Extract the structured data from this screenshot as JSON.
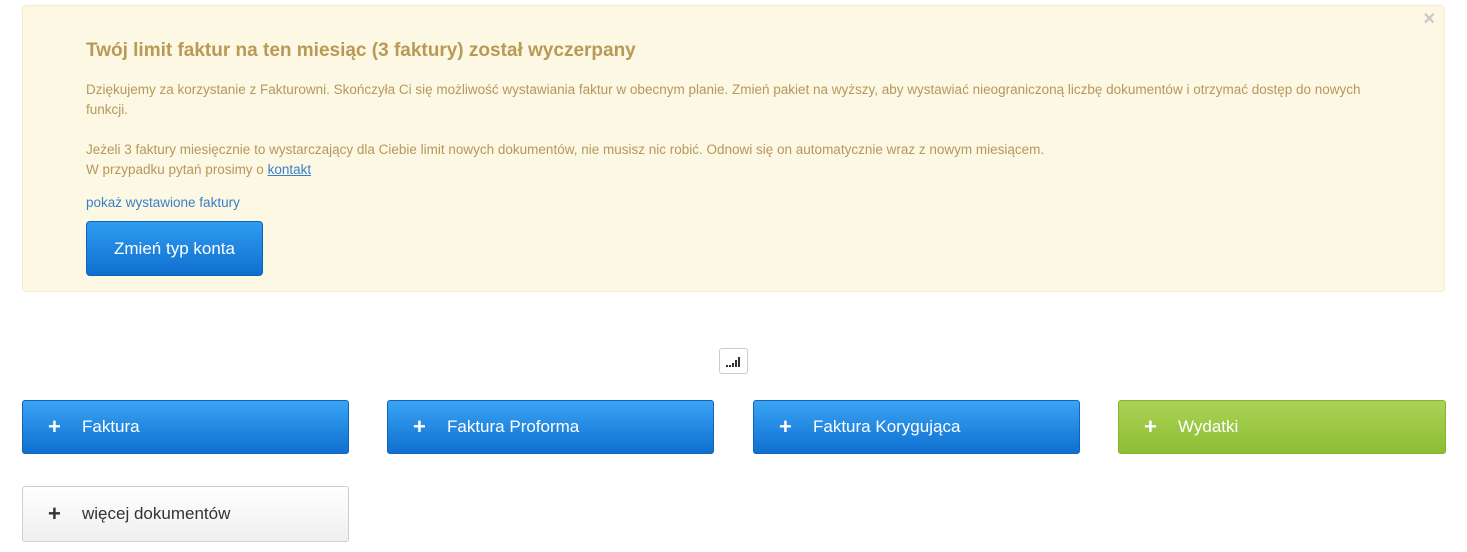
{
  "alert": {
    "close_label": "×",
    "title": "Twój limit faktur na ten miesiąc (3 faktury) został wyczerpany",
    "paragraph1": "Dziękujemy za korzystanie z Fakturowni. Skończyła Ci się możliwość wystawiania faktur w obecnym planie. Zmień pakiet na wyższy, aby wystawiać nieograniczoną liczbę dokumentów i otrzymać dostęp do nowych funkcji.",
    "paragraph2": "Jeżeli 3 faktury miesięcznie to wystarczający dla Ciebie limit nowych dokumentów, nie musisz nic robić. Odnowi się on automatycznie wraz z nowym miesiącem.",
    "paragraph3_prefix": "W przypadku pytań prosimy o ",
    "contact_link": "kontakt",
    "show_invoices_link": "pokaż wystawione faktury",
    "change_account_button": "Zmień typ konta"
  },
  "toolbar": {
    "signal_icon": "signal-bars-icon"
  },
  "documents": {
    "plus_symbol": "+",
    "buttons": [
      {
        "label": "Faktura",
        "color": "#1a80e0"
      },
      {
        "label": "Faktura Proforma",
        "color": "#1a80e0"
      },
      {
        "label": "Faktura Korygująca",
        "color": "#1a80e0"
      },
      {
        "label": "Wydatki",
        "color": "#9bc844"
      },
      {
        "label": "więcej dokumentów",
        "color": "#f5f5f5"
      }
    ]
  }
}
